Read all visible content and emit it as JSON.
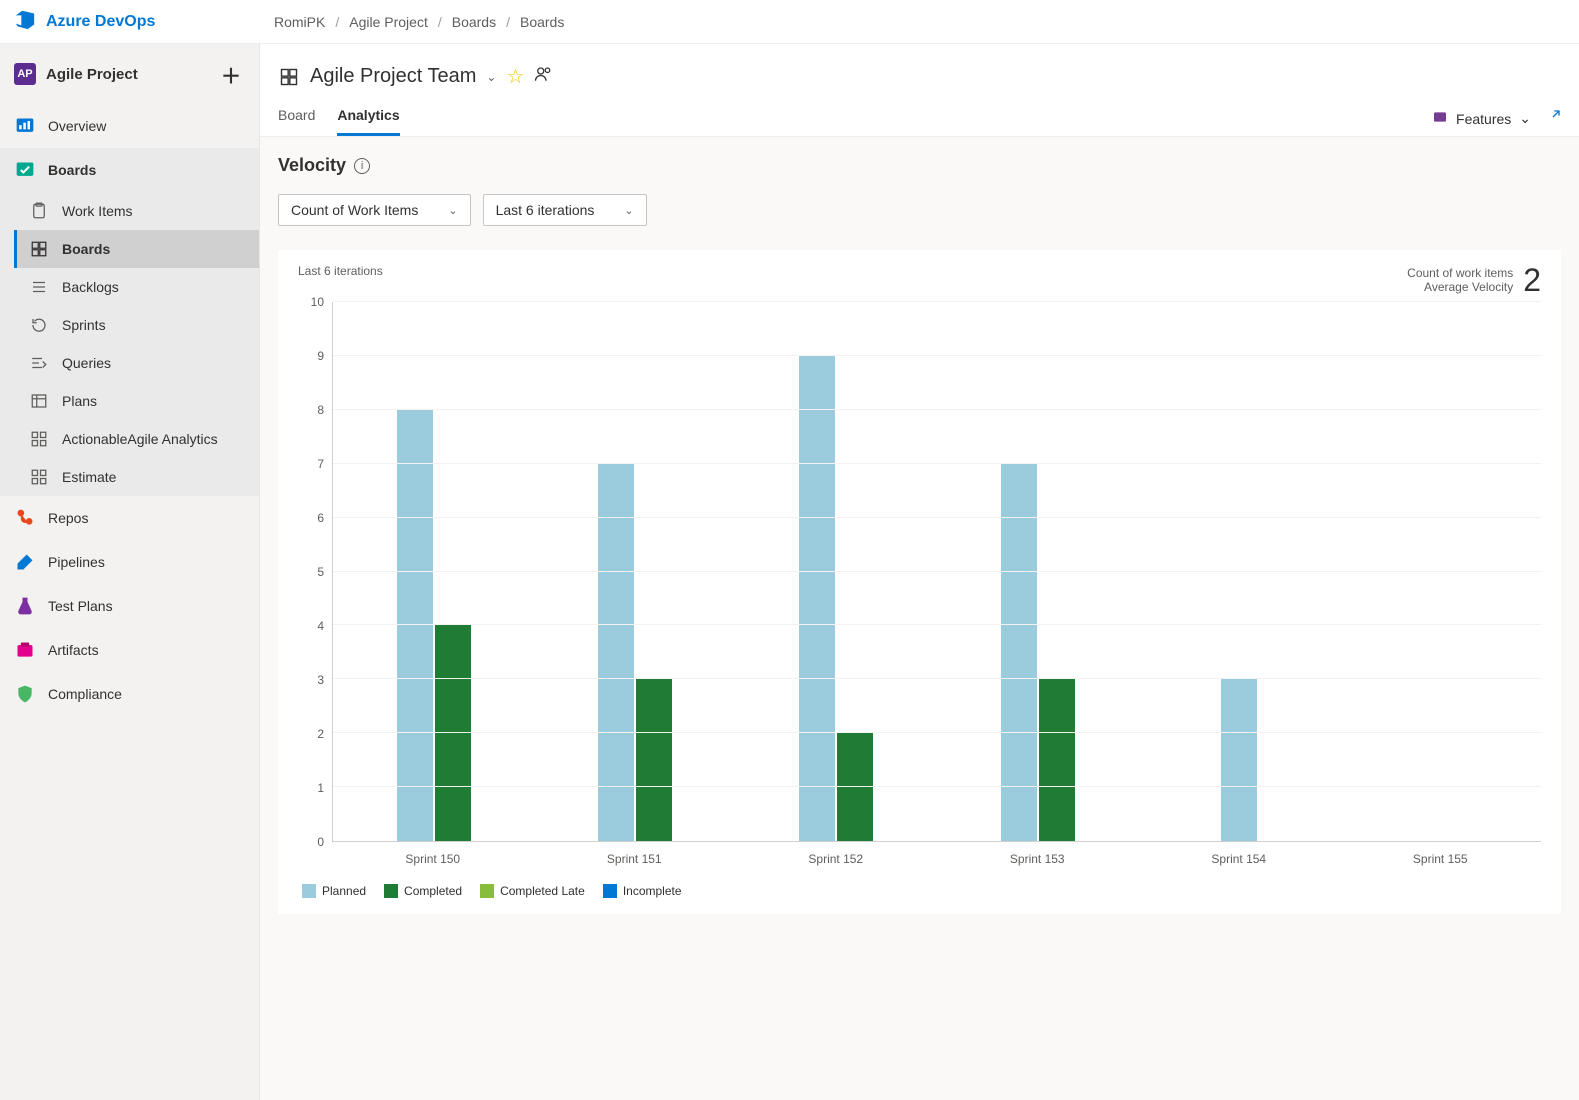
{
  "brand": "Azure DevOps",
  "breadcrumb": [
    "RomiPK",
    "Agile Project",
    "Boards",
    "Boards"
  ],
  "project": {
    "avatar": "AP",
    "name": "Agile Project"
  },
  "sidebar": {
    "items": [
      {
        "label": "Overview"
      },
      {
        "label": "Boards"
      },
      {
        "label": "Repos"
      },
      {
        "label": "Pipelines"
      },
      {
        "label": "Test Plans"
      },
      {
        "label": "Artifacts"
      },
      {
        "label": "Compliance"
      }
    ],
    "boards_sub": [
      {
        "label": "Work Items"
      },
      {
        "label": "Boards"
      },
      {
        "label": "Backlogs"
      },
      {
        "label": "Sprints"
      },
      {
        "label": "Queries"
      },
      {
        "label": "Plans"
      },
      {
        "label": "ActionableAgile Analytics"
      },
      {
        "label": "Estimate"
      }
    ]
  },
  "team": "Agile Project Team",
  "tabs": [
    "Board",
    "Analytics"
  ],
  "features_label": "Features",
  "page_title": "Velocity",
  "controls": {
    "metric": "Count of Work Items",
    "range": "Last 6 iterations"
  },
  "card": {
    "subtitle": "Last 6 iterations",
    "kpi_label1": "Count of work items",
    "kpi_label2": "Average Velocity",
    "kpi_value": "2"
  },
  "legend": [
    "Planned",
    "Completed",
    "Completed Late",
    "Incomplete"
  ],
  "chart_data": {
    "type": "bar",
    "categories": [
      "Sprint 150",
      "Sprint 151",
      "Sprint 152",
      "Sprint 153",
      "Sprint 154",
      "Sprint 155"
    ],
    "series": [
      {
        "name": "Planned",
        "values": [
          8,
          7,
          9,
          7,
          3,
          0
        ]
      },
      {
        "name": "Completed",
        "values": [
          4,
          3,
          2,
          3,
          0,
          0
        ]
      },
      {
        "name": "Completed Late",
        "values": [
          0,
          0,
          0,
          0,
          0,
          0
        ]
      },
      {
        "name": "Incomplete",
        "values": [
          0,
          0,
          0,
          0,
          0,
          0
        ]
      }
    ],
    "ylim": [
      0,
      10
    ],
    "yticks": [
      0,
      1,
      2,
      3,
      4,
      5,
      6,
      7,
      8,
      9,
      10
    ],
    "ylabel": "",
    "xlabel": "",
    "title": "Velocity"
  },
  "colors": {
    "planned": "#9bccdd",
    "completed": "#207b35",
    "completed_late": "#88bd3b",
    "incomplete": "#0078d4"
  }
}
